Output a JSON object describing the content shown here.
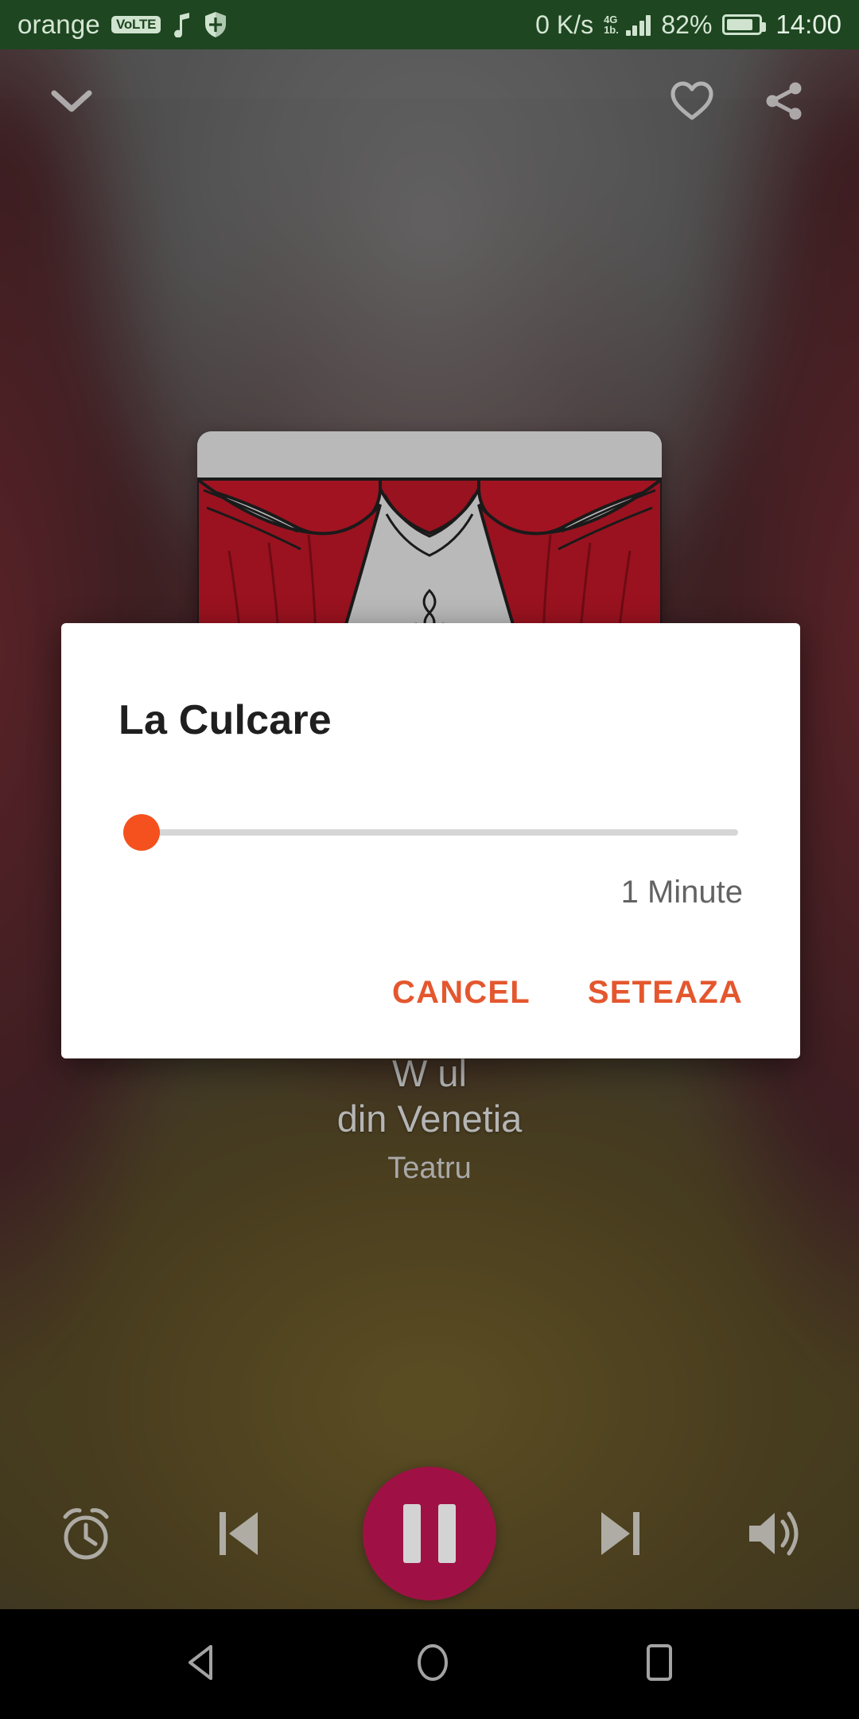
{
  "status_bar": {
    "carrier": "orange",
    "volte_badge": "VoLTE",
    "music_icon": "music-note-icon",
    "shield_icon": "shield-icon",
    "network_speed": "0 K/s",
    "network_generation": "4G",
    "network_generation_sub": "1b.",
    "battery_percent": "82%",
    "clock": "14:00",
    "background_color": "#1e4620",
    "foreground_color": "#cfe3cf"
  },
  "player": {
    "collapse_icon": "chevron-down-icon",
    "favorite_icon": "heart-outline-icon",
    "share_icon": "share-icon",
    "album_art_alt": "theater-curtains-with-comedy-tragedy-masks",
    "track_title_line1": "W                                                    ul",
    "track_title_line2": "din Venetia",
    "track_subtitle": "Teatru",
    "controls": {
      "sleep_timer_icon": "alarm-clock-icon",
      "previous_icon": "skip-previous-icon",
      "play_pause_icon": "pause-icon",
      "next_icon": "skip-next-icon",
      "volume_icon": "volume-up-icon",
      "play_button_color": "#a31247"
    }
  },
  "dialog": {
    "title": "La Culcare",
    "slider": {
      "value_percent": 0,
      "thumb_color": "#f4511e",
      "track_color": "#d6d6d6"
    },
    "duration_label": "1 Minute",
    "cancel_label": "CANCEL",
    "confirm_label": "SETEAZA",
    "accent_color": "#e4572e"
  },
  "nav_bar": {
    "back_icon": "back-triangle-icon",
    "home_icon": "home-circle-icon",
    "recents_icon": "recents-square-icon",
    "background_color": "#000000"
  }
}
